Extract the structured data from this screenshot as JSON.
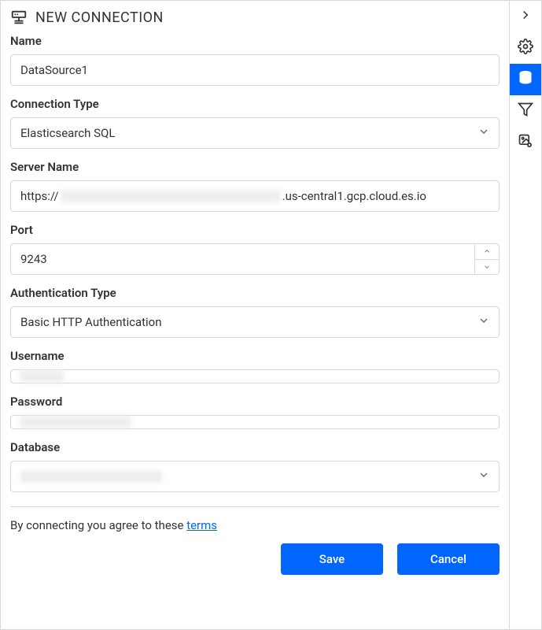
{
  "header": {
    "title": "NEW CONNECTION"
  },
  "fields": {
    "name": {
      "label": "Name",
      "value": "DataSource1"
    },
    "connectionType": {
      "label": "Connection Type",
      "value": "Elasticsearch SQL"
    },
    "serverName": {
      "label": "Server Name",
      "prefix": "https://",
      "suffix": ".us-central1.gcp.cloud.es.io"
    },
    "port": {
      "label": "Port",
      "value": "9243"
    },
    "authType": {
      "label": "Authentication Type",
      "value": "Basic HTTP Authentication"
    },
    "username": {
      "label": "Username"
    },
    "password": {
      "label": "Password"
    },
    "database": {
      "label": "Database"
    }
  },
  "terms": {
    "text": "By connecting you agree to these ",
    "link": "terms"
  },
  "buttons": {
    "save": "Save",
    "cancel": "Cancel"
  },
  "sidebar": {
    "items": [
      {
        "name": "collapse",
        "icon": "chevron-right"
      },
      {
        "name": "settings",
        "icon": "gear"
      },
      {
        "name": "datasource",
        "icon": "database",
        "active": true
      },
      {
        "name": "filter",
        "icon": "funnel"
      },
      {
        "name": "image-settings",
        "icon": "image-gear"
      }
    ]
  }
}
